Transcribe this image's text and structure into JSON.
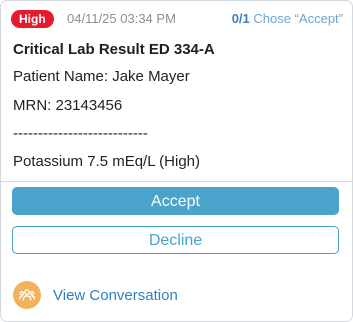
{
  "alert": {
    "priority_badge": "High",
    "timestamp": "04/11/25 03:34 PM",
    "response_count": "0/1",
    "response_text": "Chose “Accept”",
    "title": "Critical Lab Result ED 334-A",
    "lines": [
      "Patient Name: Jake Mayer",
      "MRN: 23143456",
      "---------------------------",
      "Potassium 7.5 mEq/L (High)"
    ]
  },
  "actions": {
    "accept_label": "Accept",
    "decline_label": "Decline"
  },
  "conversation": {
    "icon": "people-icon",
    "link_label": "View Conversation"
  },
  "colors": {
    "badge_red": "#e8192c",
    "accent_blue": "#4aa3cb",
    "link_blue": "#2f7fc4",
    "icon_orange": "#f1b25a"
  }
}
